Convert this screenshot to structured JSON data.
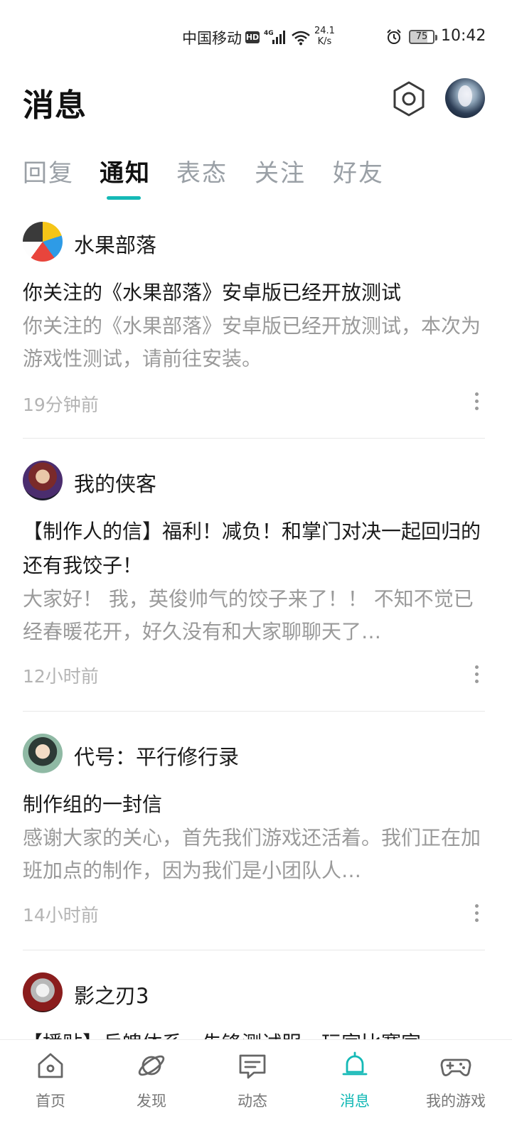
{
  "status_bar": {
    "carrier": "中国移动",
    "hd": "HD",
    "network": "4G",
    "speed_value": "24.1",
    "speed_unit": "K/s",
    "battery": "75",
    "time": "10:42"
  },
  "header": {
    "title": "消息"
  },
  "tabs": [
    {
      "label": "回复",
      "active": false
    },
    {
      "label": "通知",
      "active": true
    },
    {
      "label": "表态",
      "active": false
    },
    {
      "label": "关注",
      "active": false
    },
    {
      "label": "好友",
      "active": false
    }
  ],
  "feed": [
    {
      "source": "水果部落",
      "title": "你关注的《水果部落》安卓版已经开放测试",
      "body": "你关注的《水果部落》安卓版已经开放测试，本次为游戏性测试，请前往安装。",
      "time": "19分钟前"
    },
    {
      "source": "我的侠客",
      "title": "【制作人的信】福利！减负！和掌门对决一起回归的还有我饺子！",
      "body": "大家好！ 我，英俊帅气的饺子来了！！ 不知不觉已经春暖花开，好久没有和大家聊聊天了…",
      "time": "12小时前"
    },
    {
      "source": "代号：平行修行录",
      "title": "制作组的一封信",
      "body": "感谢大家的关心，首先我们游戏还活着。我们正在加班加点的制作，因为我们是小团队人…",
      "time": "14小时前"
    },
    {
      "source": "影之刃3",
      "title": "【播贴】兵魄体系，先锋测试服，玩家比赛宣",
      "body": "",
      "time": ""
    }
  ],
  "bottom_nav": [
    {
      "label": "首页",
      "icon": "home-icon",
      "active": false
    },
    {
      "label": "发现",
      "icon": "discover-planet-icon",
      "active": false
    },
    {
      "label": "动态",
      "icon": "chat-bubble-icon",
      "active": false
    },
    {
      "label": "消息",
      "icon": "bell-icon",
      "active": true
    },
    {
      "label": "我的游戏",
      "icon": "gamepad-icon",
      "active": false
    }
  ],
  "colors": {
    "accent": "#14b9b6",
    "text_primary": "#1a1a1a",
    "text_secondary": "#9a9a9a",
    "text_muted": "#b4b4b4"
  }
}
